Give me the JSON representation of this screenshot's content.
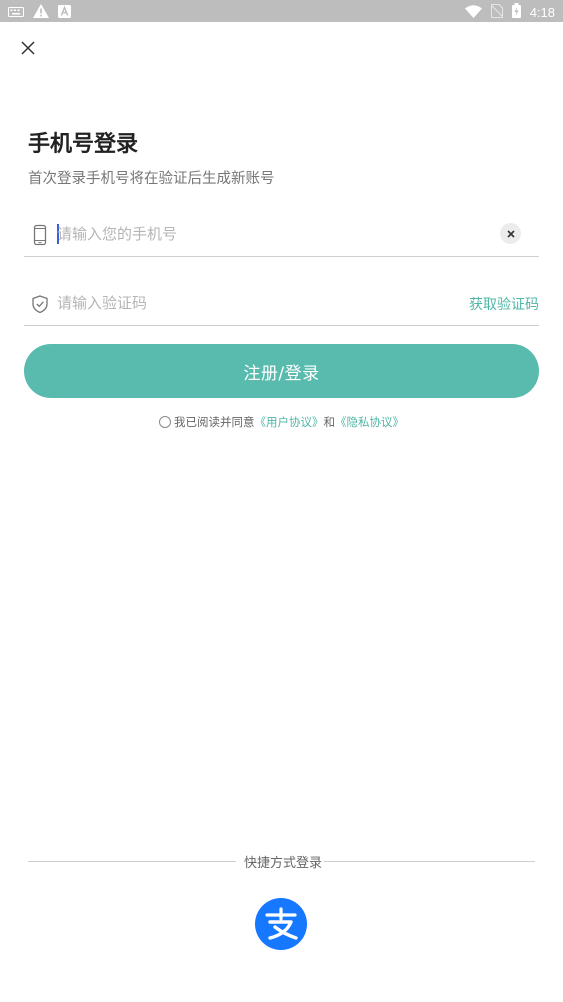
{
  "status_bar": {
    "time": "4:18",
    "left_icons": [
      "keyboard-icon",
      "warning-icon",
      "a-notification-icon"
    ],
    "right_icons": [
      "wifi-icon",
      "no-sim-icon",
      "battery-icon"
    ]
  },
  "page": {
    "title": "手机号登录",
    "subtitle": "首次登录手机号将在验证后生成新账号"
  },
  "phone_field": {
    "icon": "phone-icon",
    "placeholder": "请输入您的手机号"
  },
  "code_field": {
    "icon": "shield-check-icon",
    "placeholder": "请输入验证码",
    "get_code_label": "获取验证码"
  },
  "submit": {
    "label": "注册/登录"
  },
  "agreement": {
    "prefix": "我已阅读并同意",
    "user_agreement": "《用户协议》",
    "and": "和",
    "privacy_policy": "《隐私协议》"
  },
  "quick_login": {
    "label": "快捷方式登录",
    "icon": "alipay-icon"
  },
  "colors": {
    "accent": "#58bbae",
    "link": "#4fb6a6",
    "alipay": "#1677ff"
  }
}
